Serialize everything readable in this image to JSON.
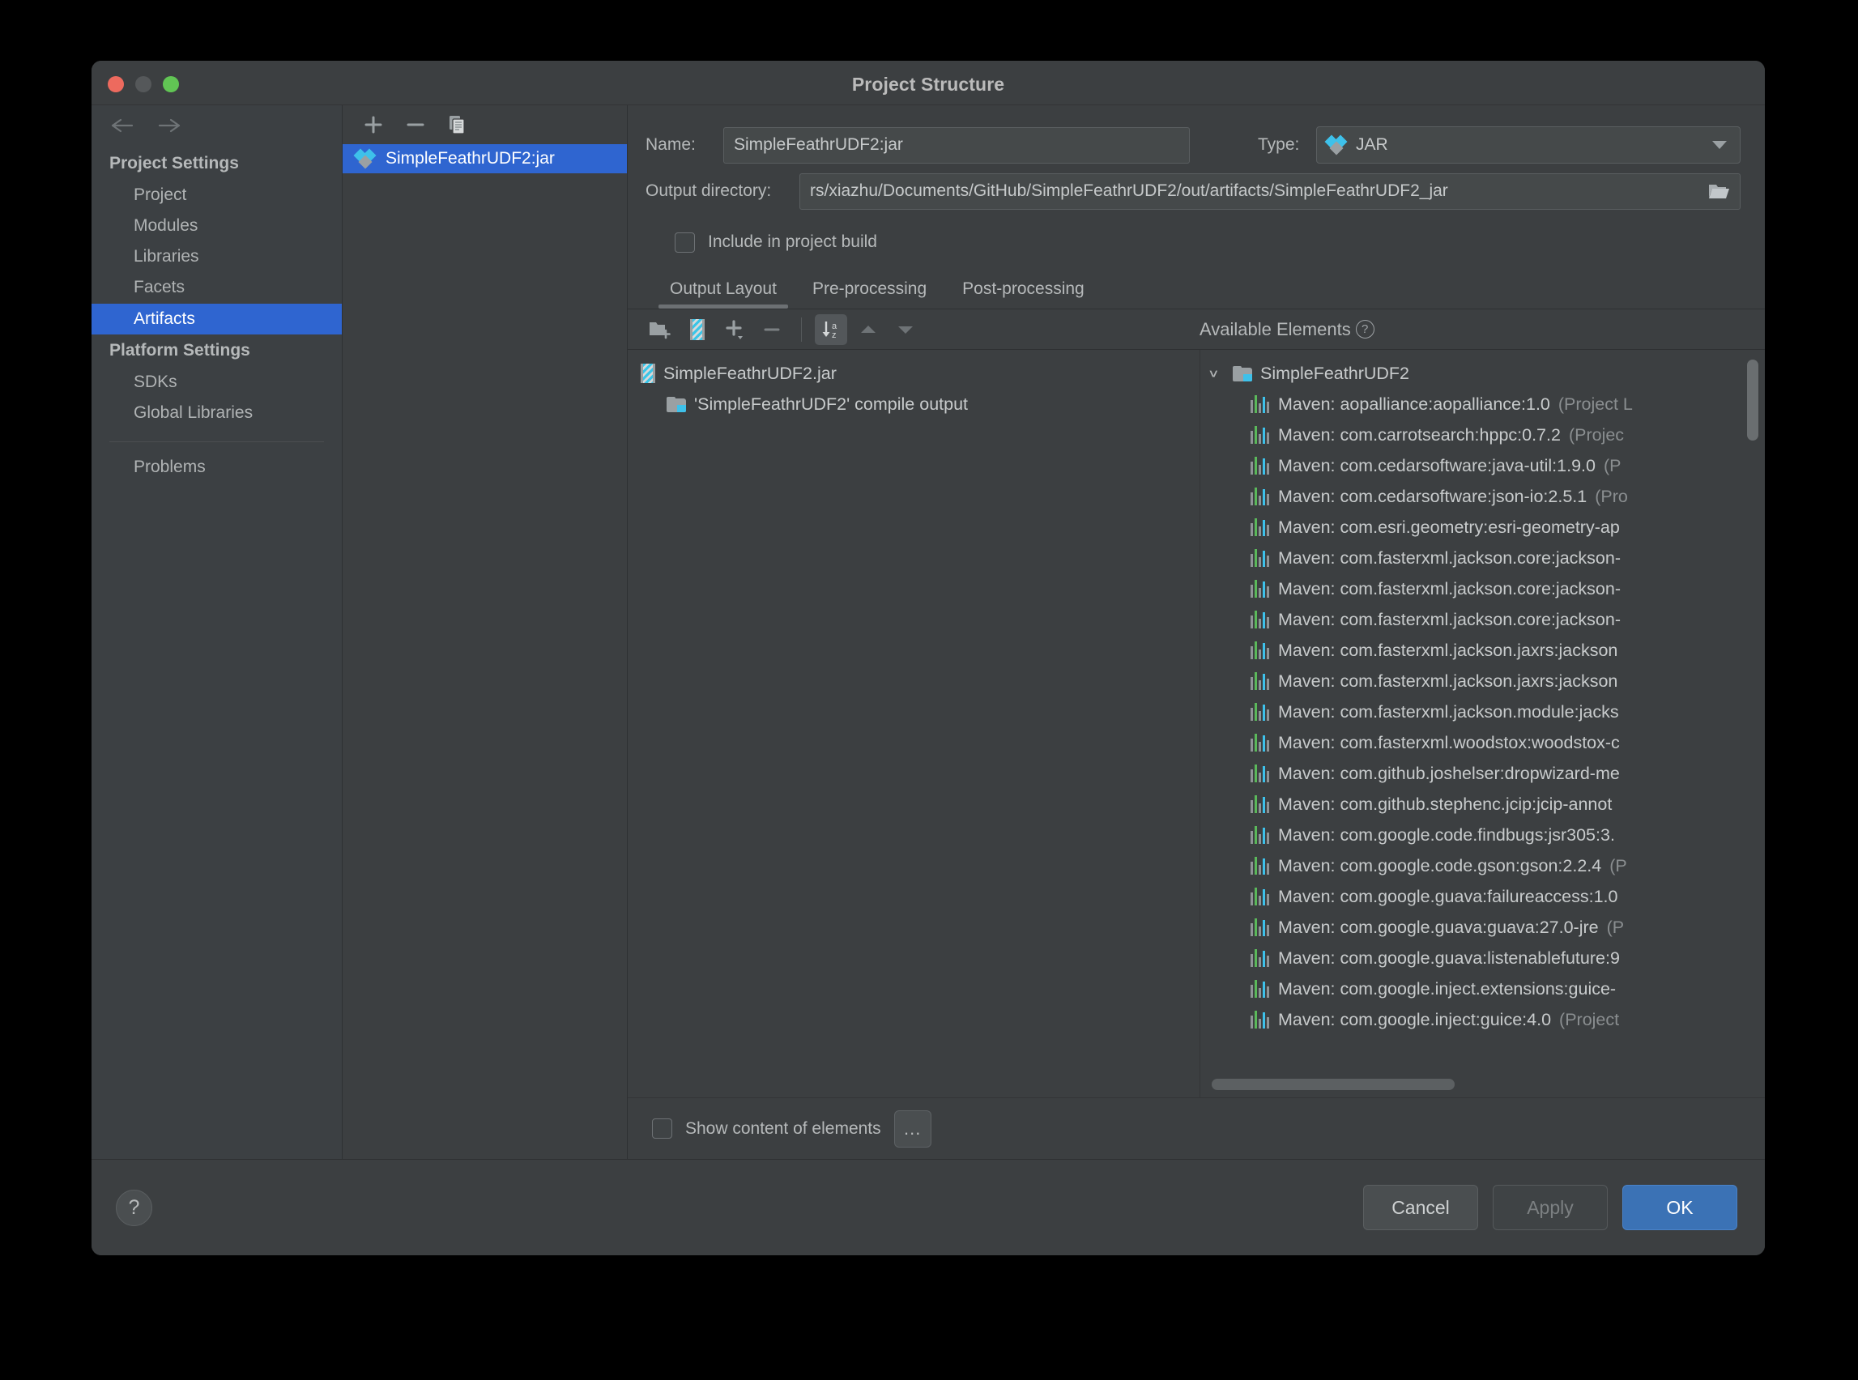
{
  "window": {
    "title": "Project Structure",
    "traffic_lights": [
      "close",
      "minimize",
      "zoom"
    ]
  },
  "sidebar": {
    "back_icon": "arrow-left-icon",
    "forward_icon": "arrow-right-icon",
    "groups": [
      {
        "title": "Project Settings",
        "items": [
          {
            "label": "Project",
            "selected": false
          },
          {
            "label": "Modules",
            "selected": false
          },
          {
            "label": "Libraries",
            "selected": false
          },
          {
            "label": "Facets",
            "selected": false
          },
          {
            "label": "Artifacts",
            "selected": true
          }
        ]
      },
      {
        "title": "Platform Settings",
        "items": [
          {
            "label": "SDKs",
            "selected": false
          },
          {
            "label": "Global Libraries",
            "selected": false
          }
        ]
      }
    ],
    "problems_label": "Problems"
  },
  "artifacts_panel": {
    "toolbar": [
      {
        "name": "add-artifact-button",
        "glyph": "+"
      },
      {
        "name": "remove-artifact-button",
        "glyph": "−"
      },
      {
        "name": "copy-artifact-button",
        "glyph": "copy-icon"
      }
    ],
    "items": [
      {
        "label": "SimpleFeathrUDF2:jar",
        "icon": "jar-artifact-icon",
        "selected": true
      }
    ]
  },
  "detail": {
    "name_label": "Name:",
    "name_value": "SimpleFeathrUDF2:jar",
    "type_label": "Type:",
    "type_value": "JAR",
    "type_icon": "jar-artifact-icon",
    "output_dir_label": "Output directory:",
    "output_dir_value": "rs/xiazhu/Documents/GitHub/SimpleFeathrUDF2/out/artifacts/SimpleFeathrUDF2_jar",
    "browse_icon": "folder-open-icon",
    "include_in_build_label": "Include in project build",
    "include_in_build_checked": false,
    "tabs": [
      {
        "label": "Output Layout",
        "active": true
      },
      {
        "label": "Pre-processing",
        "active": false
      },
      {
        "label": "Post-processing",
        "active": false
      }
    ],
    "layout_toolbar": [
      {
        "name": "create-directory-button",
        "icon": "folder-add-icon",
        "active": false
      },
      {
        "name": "create-archive-button",
        "icon": "archive-add-icon",
        "active": false
      },
      {
        "name": "add-copy-of-button",
        "icon": "plus-dropdown-icon",
        "active": false
      },
      {
        "name": "remove-element-button",
        "icon": "minus-icon",
        "active": false
      },
      {
        "name": "sort-elements-button",
        "icon": "sort-az-icon",
        "active": true
      },
      {
        "name": "move-up-button",
        "icon": "triangle-up-icon",
        "active": false
      },
      {
        "name": "move-down-button",
        "icon": "triangle-down-icon",
        "active": false
      }
    ],
    "available_elements_label": "Available Elements",
    "available_help_icon": "help-icon",
    "output_tree": [
      {
        "label": "SimpleFeathrUDF2.jar",
        "icon": "archive-icon",
        "indent": 0
      },
      {
        "label": "'SimpleFeathrUDF2' compile output",
        "icon": "module-output-icon",
        "indent": 1
      }
    ],
    "available_tree": [
      {
        "label": "SimpleFeathrUDF2",
        "suffix": "",
        "icon": "module-icon",
        "indent": 0,
        "expanded": true
      },
      {
        "label": "Maven: aopalliance:aopalliance:1.0",
        "suffix": " (Project L",
        "icon": "library-icon",
        "indent": 1
      },
      {
        "label": "Maven: com.carrotsearch:hppc:0.7.2",
        "suffix": " (Projec",
        "icon": "library-icon",
        "indent": 1
      },
      {
        "label": "Maven: com.cedarsoftware:java-util:1.9.0",
        "suffix": " (P",
        "icon": "library-icon",
        "indent": 1
      },
      {
        "label": "Maven: com.cedarsoftware:json-io:2.5.1",
        "suffix": " (Pro",
        "icon": "library-icon",
        "indent": 1
      },
      {
        "label": "Maven: com.esri.geometry:esri-geometry-ap",
        "suffix": "",
        "icon": "library-icon",
        "indent": 1
      },
      {
        "label": "Maven: com.fasterxml.jackson.core:jackson-",
        "suffix": "",
        "icon": "library-icon",
        "indent": 1
      },
      {
        "label": "Maven: com.fasterxml.jackson.core:jackson-",
        "suffix": "",
        "icon": "library-icon",
        "indent": 1
      },
      {
        "label": "Maven: com.fasterxml.jackson.core:jackson-",
        "suffix": "",
        "icon": "library-icon",
        "indent": 1
      },
      {
        "label": "Maven: com.fasterxml.jackson.jaxrs:jackson",
        "suffix": "",
        "icon": "library-icon",
        "indent": 1
      },
      {
        "label": "Maven: com.fasterxml.jackson.jaxrs:jackson",
        "suffix": "",
        "icon": "library-icon",
        "indent": 1
      },
      {
        "label": "Maven: com.fasterxml.jackson.module:jacks",
        "suffix": "",
        "icon": "library-icon",
        "indent": 1
      },
      {
        "label": "Maven: com.fasterxml.woodstox:woodstox-c",
        "suffix": "",
        "icon": "library-icon",
        "indent": 1
      },
      {
        "label": "Maven: com.github.joshelser:dropwizard-me",
        "suffix": "",
        "icon": "library-icon",
        "indent": 1
      },
      {
        "label": "Maven: com.github.stephenc.jcip:jcip-annot",
        "suffix": "",
        "icon": "library-icon",
        "indent": 1
      },
      {
        "label": "Maven: com.google.code.findbugs:jsr305:3.",
        "suffix": "",
        "icon": "library-icon",
        "indent": 1
      },
      {
        "label": "Maven: com.google.code.gson:gson:2.2.4",
        "suffix": " (P",
        "icon": "library-icon",
        "indent": 1
      },
      {
        "label": "Maven: com.google.guava:failureaccess:1.0",
        "suffix": "",
        "icon": "library-icon",
        "indent": 1
      },
      {
        "label": "Maven: com.google.guava:guava:27.0-jre",
        "suffix": " (P",
        "icon": "library-icon",
        "indent": 1
      },
      {
        "label": "Maven: com.google.guava:listenablefuture:9",
        "suffix": "",
        "icon": "library-icon",
        "indent": 1
      },
      {
        "label": "Maven: com.google.inject.extensions:guice-",
        "suffix": "",
        "icon": "library-icon",
        "indent": 1
      },
      {
        "label": "Maven: com.google.inject:guice:4.0",
        "suffix": " (Project",
        "icon": "library-icon",
        "indent": 1
      }
    ],
    "show_content_label": "Show content of elements",
    "show_content_checked": false,
    "ellipsis_button_label": "..."
  },
  "footer": {
    "help_label": "?",
    "buttons": [
      {
        "label": "Cancel",
        "kind": "cancel"
      },
      {
        "label": "Apply",
        "kind": "apply"
      },
      {
        "label": "OK",
        "kind": "ok"
      }
    ]
  },
  "colors": {
    "window_bg": "#3c3f41",
    "sidebar_bg": "#3c4043",
    "selection_blue": "#2f65d0",
    "ok_button_blue": "#3b72b5",
    "text": "#b6b9ba",
    "accent_cyan": "#3ec1ea"
  }
}
